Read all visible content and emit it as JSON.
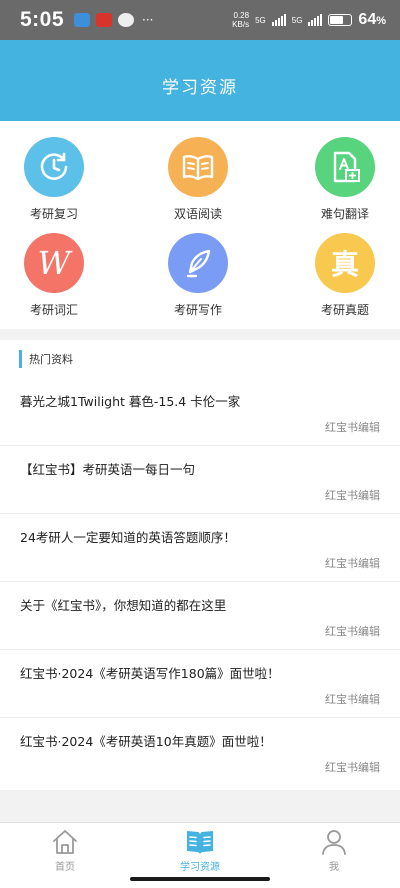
{
  "status_bar": {
    "time": "5:05",
    "more": "···",
    "speed_value": "0.28",
    "speed_unit": "KB/s",
    "net_label_1": "5G",
    "net_label_2": "5G",
    "battery_percent": "64",
    "battery_level": 0.64
  },
  "header": {
    "title": "学习资源"
  },
  "grid": [
    {
      "label": "考研复习",
      "icon": "clock-arrow-icon",
      "color": "#5cc0e8"
    },
    {
      "label": "双语阅读",
      "icon": "open-book-icon",
      "color": "#f7b155"
    },
    {
      "label": "难句翻译",
      "icon": "document-translate-icon",
      "color": "#58d37e"
    },
    {
      "label": "考研词汇",
      "icon": "letter-w-icon",
      "glyph": "W",
      "color": "#f47468"
    },
    {
      "label": "考研写作",
      "icon": "quill-icon",
      "color": "#7b9cf5"
    },
    {
      "label": "考研真题",
      "icon": "zhen-character-icon",
      "glyph": "真",
      "color": "#f9c84e"
    }
  ],
  "hot": {
    "title": "热门资料",
    "articles": [
      {
        "title": "暮光之城1Twilight 暮色-15.4 卡伦一家",
        "author": "红宝书编辑"
      },
      {
        "title": "【红宝书】考研英语一每日一句",
        "author": "红宝书编辑"
      },
      {
        "title": "24考研人一定要知道的英语答题顺序！",
        "author": "红宝书编辑"
      },
      {
        "title": "关于《红宝书》，你想知道的都在这里",
        "author": "红宝书编辑"
      },
      {
        "title": "红宝书·2024《考研英语写作180篇》面世啦！",
        "author": "红宝书编辑"
      },
      {
        "title": "红宝书·2024《考研英语10年真题》面世啦！",
        "author": "红宝书编辑"
      }
    ]
  },
  "bottom_nav": {
    "items": [
      {
        "label": "首页",
        "icon": "home-icon",
        "active": false
      },
      {
        "label": "学习资源",
        "icon": "book-icon",
        "active": true
      },
      {
        "label": "我",
        "icon": "user-icon",
        "active": false
      }
    ],
    "active_color": "#45b3e0",
    "inactive_color": "#999999"
  }
}
